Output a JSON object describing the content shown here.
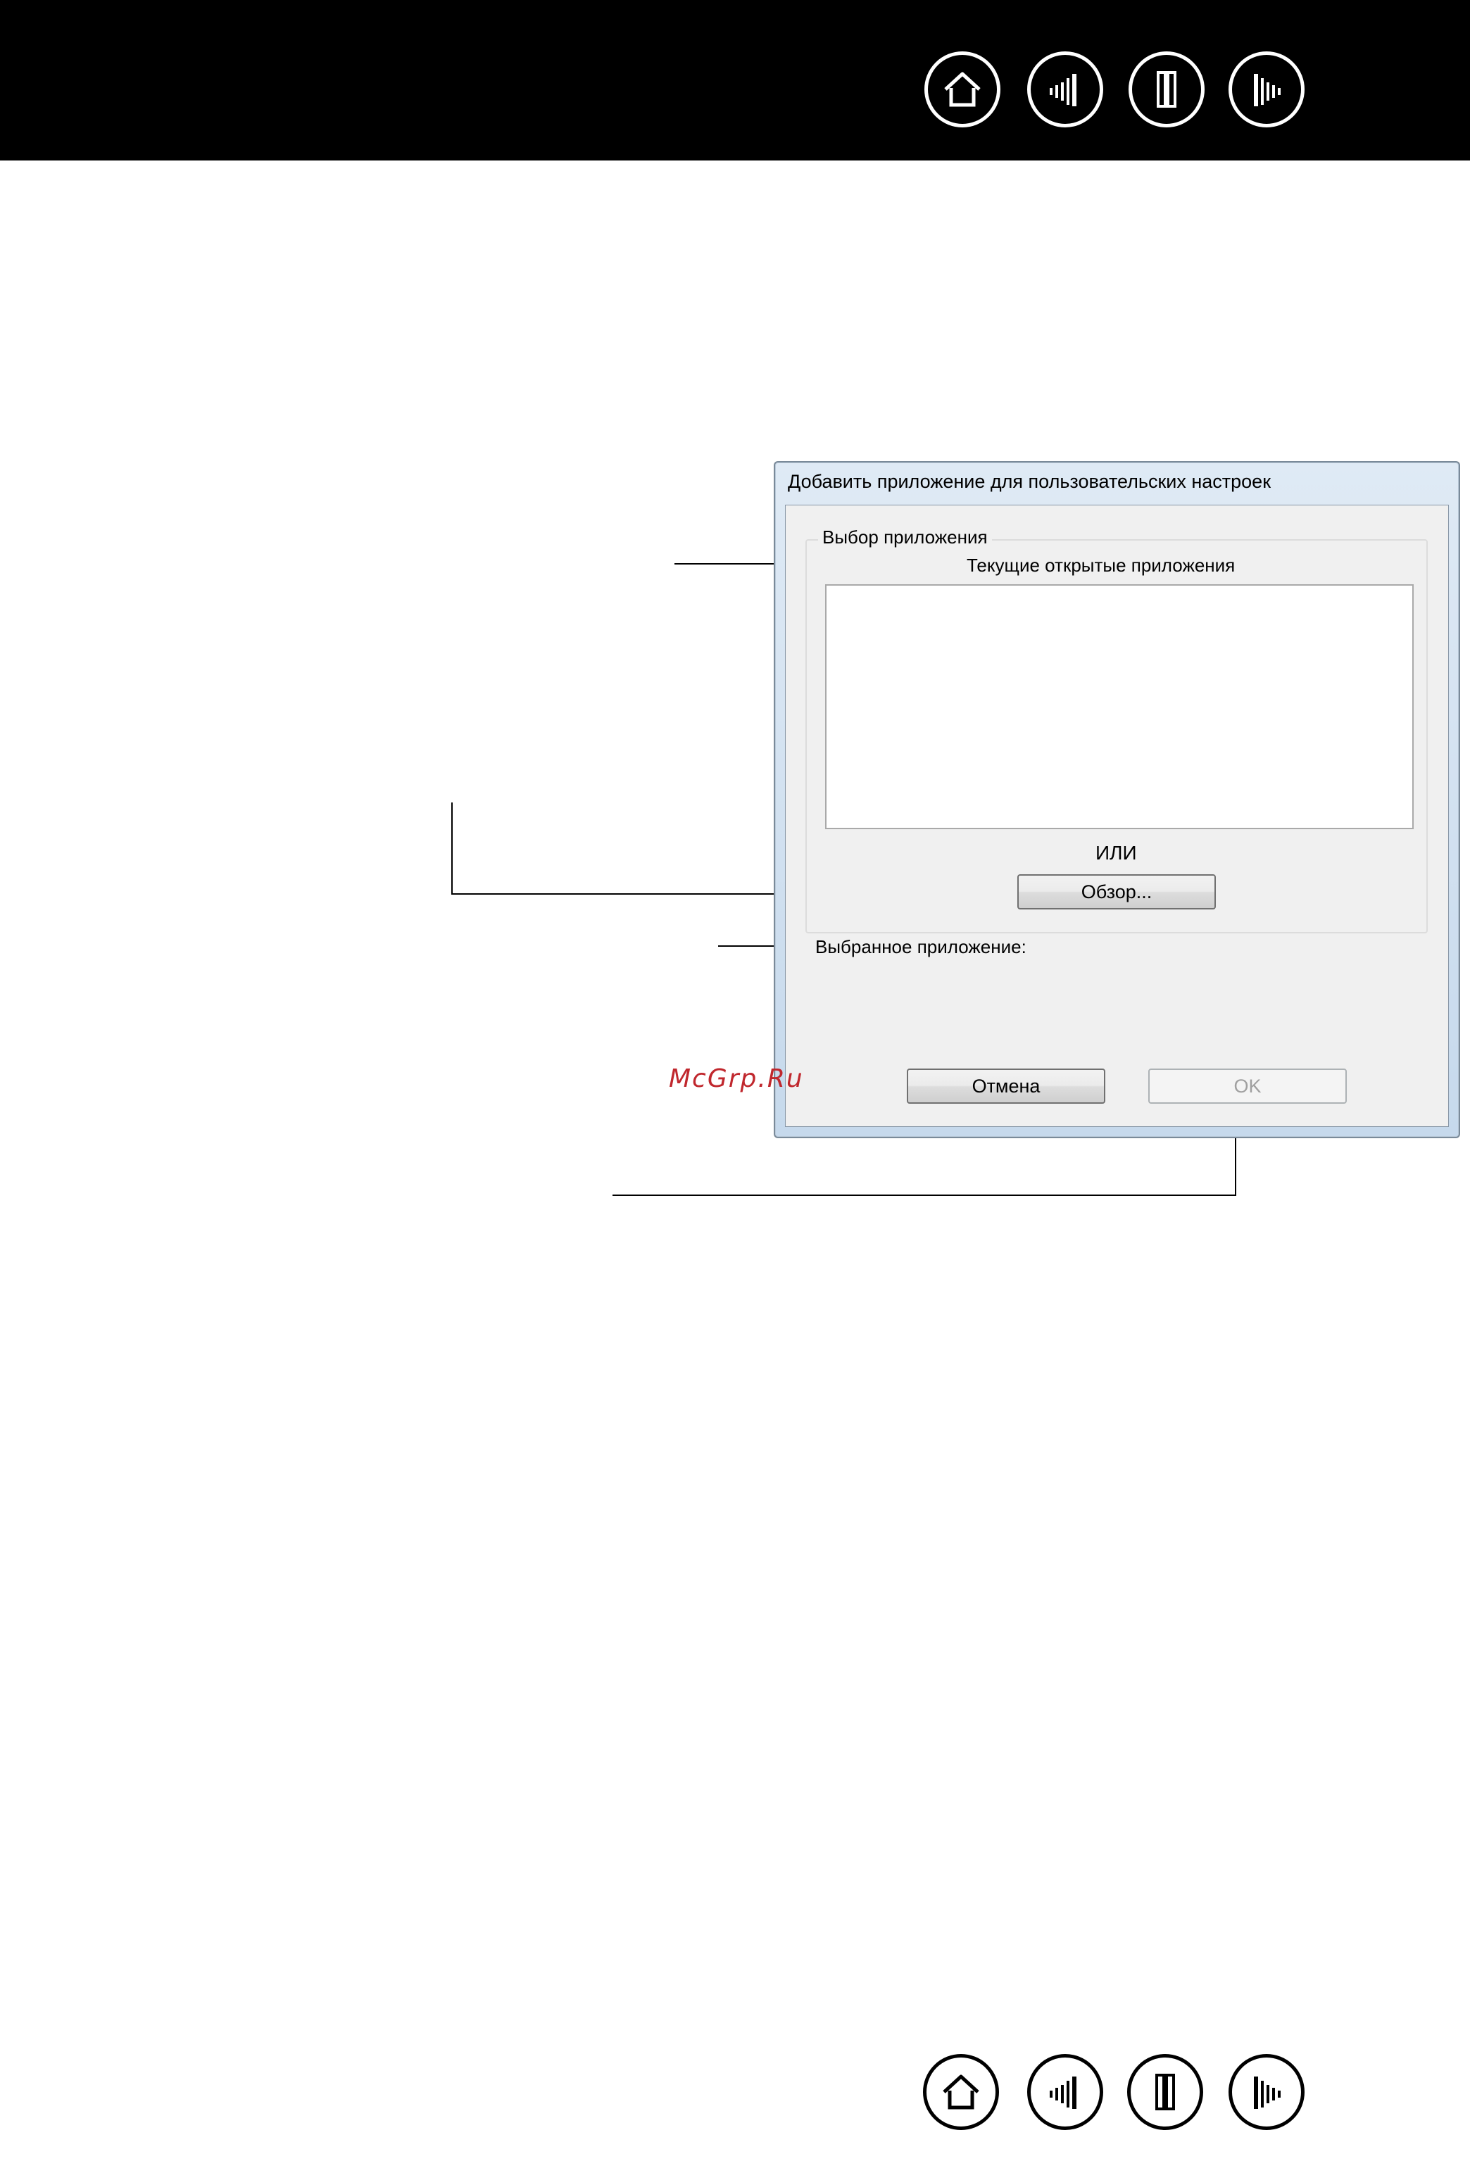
{
  "nav": {
    "buttons": [
      {
        "name": "home-button",
        "icon": "home-icon"
      },
      {
        "name": "contents-button",
        "icon": "contents-icon"
      },
      {
        "name": "section-button",
        "icon": "section-icon"
      },
      {
        "name": "index-button",
        "icon": "index-icon"
      }
    ]
  },
  "dialog": {
    "title": "Добавить приложение для пользовательских настроек",
    "group_title": "Выбор приложения",
    "open_apps_label": "Текущие открытые приложения",
    "or_label": "ИЛИ",
    "browse_button": "Обзор...",
    "selected_app_label": "Выбранное приложение:",
    "cancel_button": "Отмена",
    "ok_button": "OK"
  },
  "watermark": "McGrp.Ru",
  "colors": {
    "header": "#000000",
    "watermark": "#c0272d",
    "dialog_frame": "#c6d9ec",
    "dialog_face": "#f0f0f0"
  }
}
